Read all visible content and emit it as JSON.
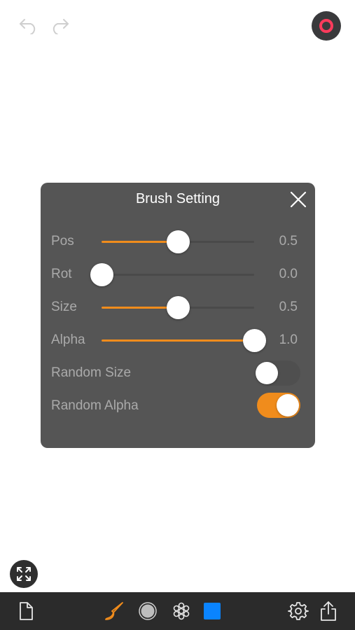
{
  "panel": {
    "title": "Brush Setting",
    "rows": [
      {
        "label": "Pos",
        "value": "0.5",
        "level": 0.5
      },
      {
        "label": "Rot",
        "value": "0.0",
        "level": 0.0
      },
      {
        "label": "Size",
        "value": "0.5",
        "level": 0.5
      },
      {
        "label": "Alpha",
        "value": "1.0",
        "level": 1.0
      }
    ],
    "toggles": [
      {
        "label": "Random Size",
        "on": false
      },
      {
        "label": "Random Alpha",
        "on": true
      }
    ]
  },
  "icons": {
    "undo": "undo-icon",
    "redo": "redo-icon",
    "record": "record-icon",
    "close": "close-icon",
    "fullscreen": "expand-icon",
    "document": "document-icon",
    "brush": "brush-icon",
    "brush_shape": "brush-shape-icon",
    "pattern": "pattern-icon",
    "color": "color-swatch",
    "settings": "gear-icon",
    "share": "share-icon"
  },
  "colors": {
    "accent": "#f08c1c",
    "panel_bg": "#555555",
    "record": "#ff3b5c",
    "current_color": "#0a84ff",
    "toolbar_bg": "#2b2b2b"
  }
}
